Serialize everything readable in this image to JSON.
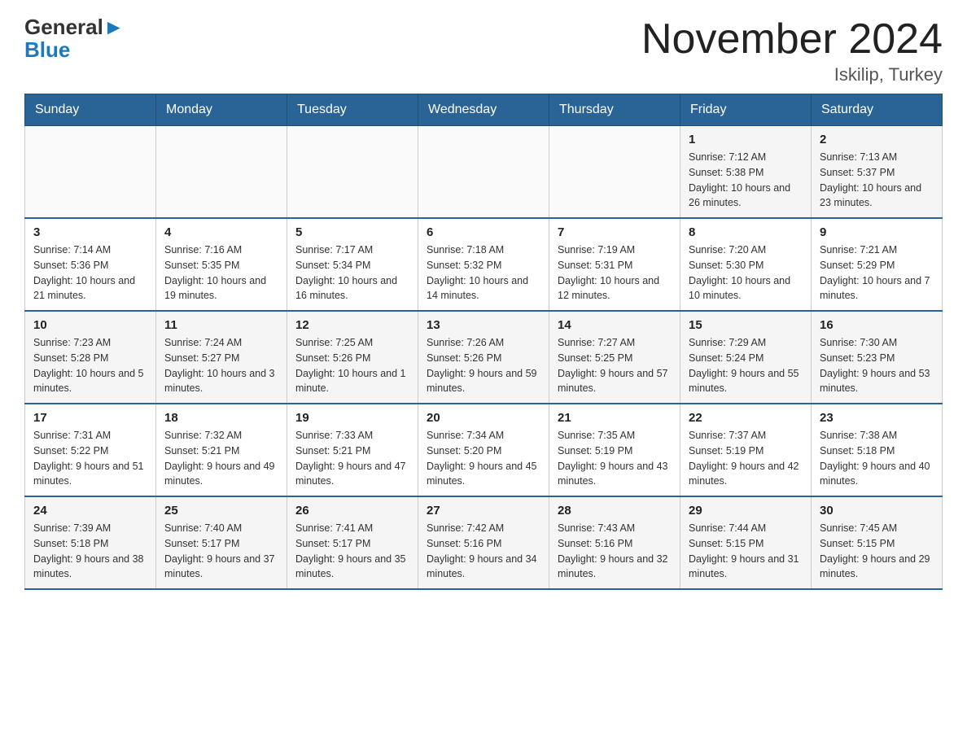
{
  "logo": {
    "general": "General",
    "blue": "Blue"
  },
  "title": "November 2024",
  "location": "Iskilip, Turkey",
  "days_of_week": [
    "Sunday",
    "Monday",
    "Tuesday",
    "Wednesday",
    "Thursday",
    "Friday",
    "Saturday"
  ],
  "weeks": [
    [
      {
        "day": "",
        "info": ""
      },
      {
        "day": "",
        "info": ""
      },
      {
        "day": "",
        "info": ""
      },
      {
        "day": "",
        "info": ""
      },
      {
        "day": "",
        "info": ""
      },
      {
        "day": "1",
        "info": "Sunrise: 7:12 AM\nSunset: 5:38 PM\nDaylight: 10 hours and 26 minutes."
      },
      {
        "day": "2",
        "info": "Sunrise: 7:13 AM\nSunset: 5:37 PM\nDaylight: 10 hours and 23 minutes."
      }
    ],
    [
      {
        "day": "3",
        "info": "Sunrise: 7:14 AM\nSunset: 5:36 PM\nDaylight: 10 hours and 21 minutes."
      },
      {
        "day": "4",
        "info": "Sunrise: 7:16 AM\nSunset: 5:35 PM\nDaylight: 10 hours and 19 minutes."
      },
      {
        "day": "5",
        "info": "Sunrise: 7:17 AM\nSunset: 5:34 PM\nDaylight: 10 hours and 16 minutes."
      },
      {
        "day": "6",
        "info": "Sunrise: 7:18 AM\nSunset: 5:32 PM\nDaylight: 10 hours and 14 minutes."
      },
      {
        "day": "7",
        "info": "Sunrise: 7:19 AM\nSunset: 5:31 PM\nDaylight: 10 hours and 12 minutes."
      },
      {
        "day": "8",
        "info": "Sunrise: 7:20 AM\nSunset: 5:30 PM\nDaylight: 10 hours and 10 minutes."
      },
      {
        "day": "9",
        "info": "Sunrise: 7:21 AM\nSunset: 5:29 PM\nDaylight: 10 hours and 7 minutes."
      }
    ],
    [
      {
        "day": "10",
        "info": "Sunrise: 7:23 AM\nSunset: 5:28 PM\nDaylight: 10 hours and 5 minutes."
      },
      {
        "day": "11",
        "info": "Sunrise: 7:24 AM\nSunset: 5:27 PM\nDaylight: 10 hours and 3 minutes."
      },
      {
        "day": "12",
        "info": "Sunrise: 7:25 AM\nSunset: 5:26 PM\nDaylight: 10 hours and 1 minute."
      },
      {
        "day": "13",
        "info": "Sunrise: 7:26 AM\nSunset: 5:26 PM\nDaylight: 9 hours and 59 minutes."
      },
      {
        "day": "14",
        "info": "Sunrise: 7:27 AM\nSunset: 5:25 PM\nDaylight: 9 hours and 57 minutes."
      },
      {
        "day": "15",
        "info": "Sunrise: 7:29 AM\nSunset: 5:24 PM\nDaylight: 9 hours and 55 minutes."
      },
      {
        "day": "16",
        "info": "Sunrise: 7:30 AM\nSunset: 5:23 PM\nDaylight: 9 hours and 53 minutes."
      }
    ],
    [
      {
        "day": "17",
        "info": "Sunrise: 7:31 AM\nSunset: 5:22 PM\nDaylight: 9 hours and 51 minutes."
      },
      {
        "day": "18",
        "info": "Sunrise: 7:32 AM\nSunset: 5:21 PM\nDaylight: 9 hours and 49 minutes."
      },
      {
        "day": "19",
        "info": "Sunrise: 7:33 AM\nSunset: 5:21 PM\nDaylight: 9 hours and 47 minutes."
      },
      {
        "day": "20",
        "info": "Sunrise: 7:34 AM\nSunset: 5:20 PM\nDaylight: 9 hours and 45 minutes."
      },
      {
        "day": "21",
        "info": "Sunrise: 7:35 AM\nSunset: 5:19 PM\nDaylight: 9 hours and 43 minutes."
      },
      {
        "day": "22",
        "info": "Sunrise: 7:37 AM\nSunset: 5:19 PM\nDaylight: 9 hours and 42 minutes."
      },
      {
        "day": "23",
        "info": "Sunrise: 7:38 AM\nSunset: 5:18 PM\nDaylight: 9 hours and 40 minutes."
      }
    ],
    [
      {
        "day": "24",
        "info": "Sunrise: 7:39 AM\nSunset: 5:18 PM\nDaylight: 9 hours and 38 minutes."
      },
      {
        "day": "25",
        "info": "Sunrise: 7:40 AM\nSunset: 5:17 PM\nDaylight: 9 hours and 37 minutes."
      },
      {
        "day": "26",
        "info": "Sunrise: 7:41 AM\nSunset: 5:17 PM\nDaylight: 9 hours and 35 minutes."
      },
      {
        "day": "27",
        "info": "Sunrise: 7:42 AM\nSunset: 5:16 PM\nDaylight: 9 hours and 34 minutes."
      },
      {
        "day": "28",
        "info": "Sunrise: 7:43 AM\nSunset: 5:16 PM\nDaylight: 9 hours and 32 minutes."
      },
      {
        "day": "29",
        "info": "Sunrise: 7:44 AM\nSunset: 5:15 PM\nDaylight: 9 hours and 31 minutes."
      },
      {
        "day": "30",
        "info": "Sunrise: 7:45 AM\nSunset: 5:15 PM\nDaylight: 9 hours and 29 minutes."
      }
    ]
  ]
}
